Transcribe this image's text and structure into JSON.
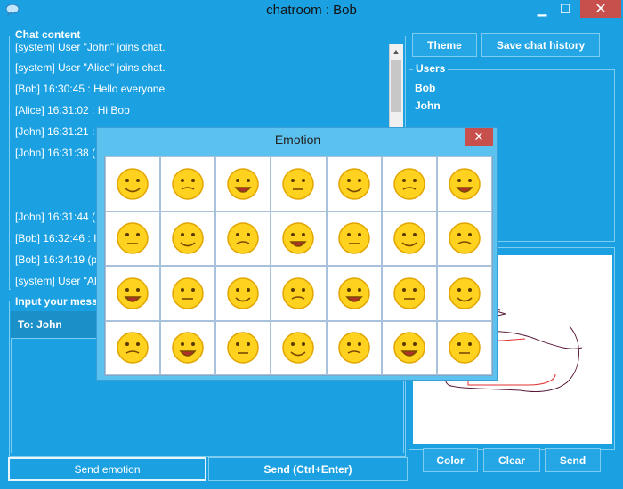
{
  "window": {
    "title": "chatroom : Bob",
    "min_glyph": "▁",
    "max_glyph": "☐",
    "close_glyph": "✕"
  },
  "chat": {
    "title": "Chat content",
    "lines": [
      "[system] User \"John\" joins chat.",
      "[system] User \"Alice\" joins chat.",
      "[Bob] 16:30:45 : Hello everyone",
      "[Alice] 16:31:02 : Hi Bob",
      "[John] 16:31:21 :",
      "[John] 16:31:38 (",
      "[John] 16:31:44 (",
      "[Bob] 16:32:46 : I",
      "[Bob] 16:34:19 (p",
      "[system] User \"Al"
    ]
  },
  "input": {
    "title": "Input your mess",
    "to_label": "To: John"
  },
  "buttons": {
    "send_emotion": "Send emotion",
    "send_ctrl": "Send (Ctrl+Enter)",
    "theme": "Theme",
    "save_history": "Save chat history",
    "color": "Color",
    "clear": "Clear",
    "send": "Send"
  },
  "users": {
    "title": "Users",
    "items": [
      "Bob",
      "John"
    ]
  },
  "emotion": {
    "title": "Emotion",
    "close_glyph": "✕",
    "count": 28
  },
  "colors": {
    "accent": "#1ba1e2",
    "dialog": "#5bc1ee",
    "close": "#c7504d",
    "sketch_dark": "#5a1a3a",
    "sketch_red": "#e03030"
  }
}
